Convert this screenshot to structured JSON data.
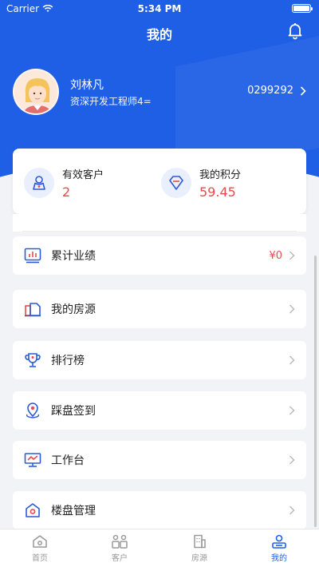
{
  "status_bar": {
    "carrier": "Carrier",
    "time": "5:34 PM"
  },
  "nav": {
    "title": "我的"
  },
  "profile": {
    "name": "刘林凡",
    "title": "资深开发工程师4=",
    "id": "0299292"
  },
  "stats": [
    {
      "label": "有效客户",
      "value": "2",
      "icon": "user-shield-icon"
    },
    {
      "label": "我的积分",
      "value": "59.45",
      "icon": "diamond-icon"
    }
  ],
  "menu": [
    {
      "label": "累计业绩",
      "value": "¥0",
      "icon": "chart-icon"
    },
    {
      "label": "我的房源",
      "icon": "building-icon"
    },
    {
      "label": "排行榜",
      "icon": "trophy-icon"
    },
    {
      "label": "踩盘签到",
      "icon": "location-icon"
    },
    {
      "label": "工作台",
      "icon": "monitor-icon"
    },
    {
      "label": "楼盘管理",
      "icon": "house-icon"
    }
  ],
  "tabs": [
    {
      "label": "首页",
      "icon": "home-icon"
    },
    {
      "label": "客户",
      "icon": "clients-icon"
    },
    {
      "label": "房源",
      "icon": "building-icon"
    },
    {
      "label": "我的",
      "icon": "profile-icon"
    }
  ],
  "colors": {
    "primary": "#1f5fe6",
    "accent_red": "#e84b4b",
    "background": "#f2f3f7"
  }
}
